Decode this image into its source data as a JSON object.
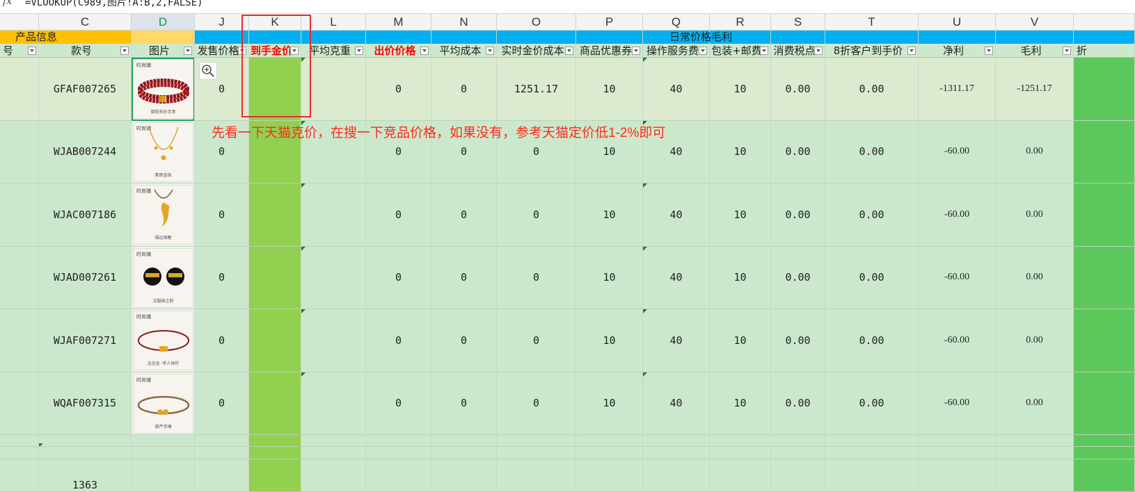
{
  "formula_bar": {
    "fx_label": "fx",
    "formula": "=VLOOKUP(C989,图片!A:B,2,FALSE)"
  },
  "groups": {
    "product_info": "产品信息",
    "daily_margin": "日常价格毛利"
  },
  "headers": {
    "B": {
      "col": "",
      "field": "号"
    },
    "C": {
      "col": "C",
      "field": "款号"
    },
    "D": {
      "col": "D",
      "field": "图片"
    },
    "J": {
      "col": "J",
      "field": "发售价格"
    },
    "K": {
      "col": "K",
      "field": "到手金价"
    },
    "L": {
      "col": "L",
      "field": "平均克重"
    },
    "M": {
      "col": "M",
      "field": "出价价格"
    },
    "N": {
      "col": "N",
      "field": "平均成本"
    },
    "O": {
      "col": "O",
      "field": "实时金价成本"
    },
    "P": {
      "col": "P",
      "field": "商品优惠券"
    },
    "Q": {
      "col": "Q",
      "field": "操作服务费"
    },
    "R": {
      "col": "R",
      "field": "包装+邮费"
    },
    "S": {
      "col": "S",
      "field": "消费税点"
    },
    "T": {
      "col": "T",
      "field": "8折客户到手价"
    },
    "U": {
      "col": "U",
      "field": "净利"
    },
    "V": {
      "col": "V",
      "field": "毛利"
    },
    "W": {
      "col": "",
      "field": "折"
    }
  },
  "rows": [
    {
      "C": "GFAF007265",
      "img_icon": "garnet-bracelet-icon",
      "img_caption": "御前朱砂手串",
      "J": "0",
      "K": "",
      "L": "",
      "M": "0",
      "N": "0",
      "O": "1251.17",
      "P": "10",
      "Q": "40",
      "R": "10",
      "S": "0.00",
      "T": "0.00",
      "U": "-1311.17",
      "V": "-1251.17"
    },
    {
      "C": "WJAB007244",
      "img_icon": "gold-necklace-icon",
      "img_caption": "素颜金珠",
      "J": "0",
      "K": "",
      "L": "",
      "M": "0",
      "N": "0",
      "O": "0",
      "P": "10",
      "Q": "40",
      "R": "10",
      "S": "0.00",
      "T": "0.00",
      "U": "-60.00",
      "V": "0.00"
    },
    {
      "C": "WJAC007186",
      "img_icon": "fish-pendant-icon",
      "img_caption": "福运锦鲤",
      "J": "0",
      "K": "",
      "L": "",
      "M": "0",
      "N": "0",
      "O": "0",
      "P": "10",
      "Q": "40",
      "R": "10",
      "S": "0.00",
      "T": "0.00",
      "U": "-60.00",
      "V": "0.00"
    },
    {
      "C": "WJAD007261",
      "img_icon": "tiger-earrings-icon",
      "img_caption": "汉服纳之韵",
      "J": "0",
      "K": "",
      "L": "",
      "M": "0",
      "N": "0",
      "O": "0",
      "P": "10",
      "Q": "40",
      "R": "10",
      "S": "0.00",
      "T": "0.00",
      "U": "-60.00",
      "V": "0.00"
    },
    {
      "C": "WJAF007271",
      "img_icon": "red-rope-bracelet-icon",
      "img_caption": "吉念金·苹人钟伴",
      "J": "0",
      "K": "",
      "L": "",
      "M": "0",
      "N": "0",
      "O": "0",
      "P": "10",
      "Q": "40",
      "R": "10",
      "S": "0.00",
      "T": "0.00",
      "U": "-60.00",
      "V": "0.00"
    },
    {
      "C": "WQAF007315",
      "img_icon": "gourd-bracelet-icon",
      "img_caption": "葫芦手绳",
      "J": "0",
      "K": "",
      "L": "",
      "M": "0",
      "N": "0",
      "O": "0",
      "P": "10",
      "Q": "40",
      "R": "10",
      "S": "0.00",
      "T": "0.00",
      "U": "-60.00",
      "V": "0.00"
    }
  ],
  "brand_mark": "时尚铺",
  "total_row": {
    "C": "1363"
  },
  "annotation": "先看一下天猫克价，在搜一下竞品价格，如果没有，参考天猫定价低1-2%即可",
  "colors": {
    "row_highlight": "#dcebd0",
    "row_default": "#cce8cc",
    "column_k": "#92d050",
    "product_header": "#ffc000",
    "daily_header": "#00b0f0",
    "annotation_red": "#ff2a1a"
  }
}
